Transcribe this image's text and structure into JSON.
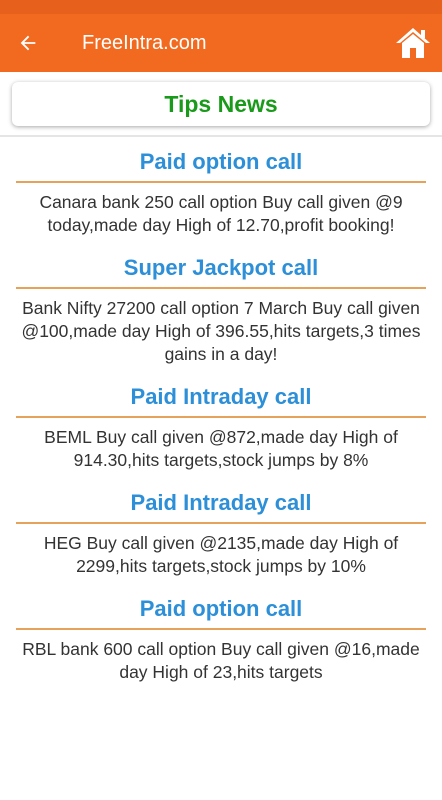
{
  "appbar": {
    "title": "FreeIntra.com",
    "back_icon": "arrow-back-icon",
    "home_icon": "home-icon",
    "color": "#f26a1f"
  },
  "header": {
    "label": "Tips News",
    "color": "#1a9a1a"
  },
  "news": [
    {
      "title": "Paid option call",
      "body": "Canara bank 250 call option Buy call given @9 today,made day High of 12.70,profit booking!"
    },
    {
      "title": "Super Jackpot call",
      "body": "Bank Nifty 27200 call option 7 March Buy call given @100,made day High of 396.55,hits targets,3 times gains in a day!"
    },
    {
      "title": "Paid Intraday call",
      "body": "BEML Buy call given @872,made day High of 914.30,hits targets,stock jumps by 8%"
    },
    {
      "title": "Paid Intraday call",
      "body": "HEG Buy call given @2135,made day High of 2299,hits targets,stock jumps by 10%"
    },
    {
      "title": "Paid option call",
      "body": "RBL bank 600 call option Buy call given @16,made day High of 23,hits targets"
    }
  ],
  "colors": {
    "title_blue": "#2c8fd8",
    "rule_orange": "#e6a25a"
  }
}
